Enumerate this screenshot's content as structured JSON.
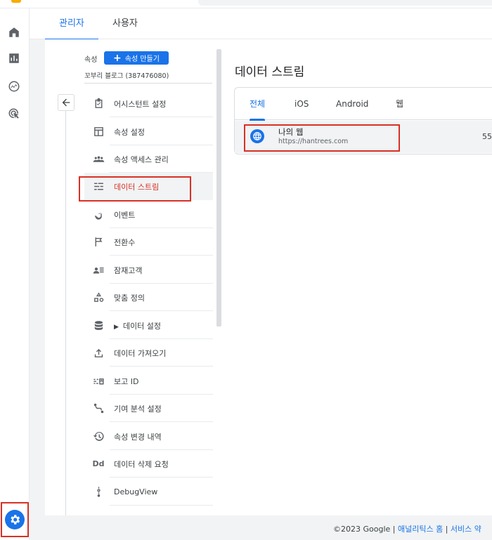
{
  "header": {
    "tabs": [
      {
        "label": "관리자",
        "active": true
      },
      {
        "label": "사용자",
        "active": false
      }
    ]
  },
  "rail": {
    "items": [
      "home-icon",
      "reports-icon",
      "explore-icon",
      "advertising-icon"
    ],
    "settings": "gear-icon"
  },
  "property": {
    "label": "속성",
    "create_button": "속성 만들기",
    "name": "꼬부리 블로그 (387476080)"
  },
  "nav": {
    "items": [
      {
        "label": "어시스턴트 설정",
        "icon": "checklist-icon"
      },
      {
        "label": "속성 설정",
        "icon": "window-icon"
      },
      {
        "label": "속성 액세스 관리",
        "icon": "people-icon"
      },
      {
        "label": "데이터 스트림",
        "icon": "streams-icon",
        "selected": true
      },
      {
        "label": "이벤트",
        "icon": "touch-icon"
      },
      {
        "label": "전환수",
        "icon": "flag-icon"
      },
      {
        "label": "잠재고객",
        "icon": "audience-icon"
      },
      {
        "label": "맞춤 정의",
        "icon": "shapes-icon"
      },
      {
        "label": "데이터 설정",
        "icon": "database-icon"
      },
      {
        "label": "데이터 가져오기",
        "icon": "upload-icon"
      },
      {
        "label": "보고 ID",
        "icon": "report-id-icon"
      },
      {
        "label": "기여 분석 설정",
        "icon": "attribution-icon"
      },
      {
        "label": "속성 변경 내역",
        "icon": "history-icon"
      },
      {
        "label": "데이터 삭제 요청",
        "icon": "dd-icon"
      },
      {
        "label": "DebugView",
        "icon": "debug-icon"
      }
    ]
  },
  "streams": {
    "title": "데이터 스트림",
    "tabs": [
      {
        "label": "전체",
        "active": true
      },
      {
        "label": "iOS",
        "active": false
      },
      {
        "label": "Android",
        "active": false
      },
      {
        "label": "웹",
        "active": false
      }
    ],
    "rows": [
      {
        "name": "나의 웹",
        "url": "https://hantrees.com",
        "id": "55"
      }
    ]
  },
  "footer": {
    "copyright": "©2023 Google",
    "links": [
      "애널리틱스 홈",
      "서비스 약"
    ]
  },
  "colors": {
    "accent": "#1a73e8",
    "highlight": "#d93025"
  }
}
